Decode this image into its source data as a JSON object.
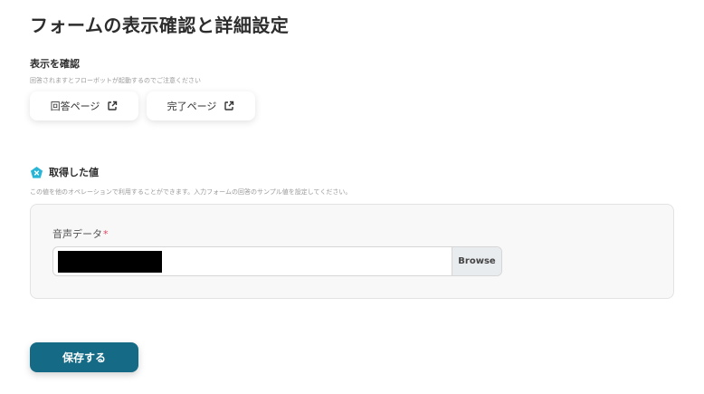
{
  "page": {
    "title": "フォームの表示確認と詳細設定"
  },
  "display_check": {
    "label": "表示を確認",
    "hint": "回答されますとフローボットが起動するのでご注意ください",
    "answer_page_button": "回答ページ",
    "done_page_button": "完了ページ",
    "icon": "external-link-icon"
  },
  "acquired_value": {
    "label": "取得した値",
    "icon": "pentagon-x-icon",
    "icon_color": "#29b6d6",
    "hint": "この値を他のオペレーションで利用することができます。入力フォームの回答のサンプル値を設定してください。"
  },
  "field": {
    "label": "音声データ",
    "required_mark": "*",
    "browse_label": "Browse"
  },
  "footer": {
    "save_label": "保存する",
    "save_color": "#156b86"
  }
}
